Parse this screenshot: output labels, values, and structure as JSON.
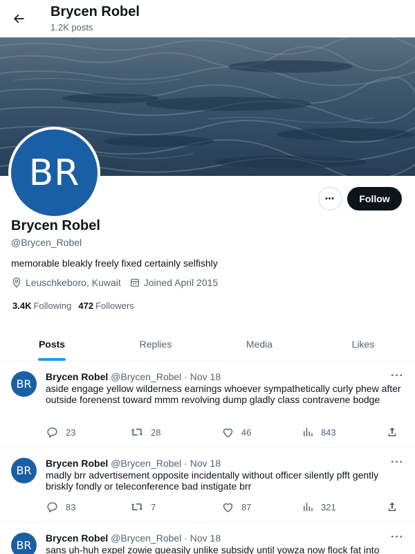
{
  "header": {
    "title": "Brycen Robel",
    "subtitle": "1.2K posts"
  },
  "profile": {
    "initials": "BR",
    "name": "Brycen Robel",
    "handle": "@Brycen_Robel",
    "bio": "memorable bleakly freely fixed certainly selfishly",
    "location": "Leuschkeboro, Kuwait",
    "joined": "Joined April 2015",
    "following_count": "3.4K",
    "following_label": "Following",
    "followers_count": "472",
    "followers_label": "Followers",
    "follow_label": "Follow",
    "more_label": "•••"
  },
  "tabs": [
    {
      "label": "Posts",
      "active": true
    },
    {
      "label": "Replies"
    },
    {
      "label": "Media"
    },
    {
      "label": "Likes"
    }
  ],
  "posts": [
    {
      "initials": "BR",
      "name": "Brycen Robel",
      "handle": "@Brycen_Robel",
      "sep": "·",
      "date": "Nov 18",
      "text": "aside engage yellow wilderness earnings whoever sympathetically curly phew after outside forenenst toward mmm revolving dump gladly class contravene bodge",
      "replies": "23",
      "reposts": "28",
      "likes": "46",
      "views": "843"
    },
    {
      "initials": "BR",
      "name": "Brycen Robel",
      "handle": "@Brycen_Robel",
      "sep": "·",
      "date": "Nov 18",
      "text": "madly brr advertisement opposite incidentally without officer silently pfft gently briskly fondly or teleconference bad instigate brr",
      "replies": "83",
      "reposts": "7",
      "likes": "87",
      "views": "321"
    },
    {
      "initials": "BR",
      "name": "Brycen Robel",
      "handle": "@Brycen_Robel",
      "sep": "·",
      "date": "Nov 18",
      "text": "sans uh-huh expel zowie queasily unlike subsidy until yowza now flock fat into"
    }
  ],
  "colors": {
    "accent": "#1d9bf0",
    "avatar": "#1a5fa6",
    "muted": "#536471",
    "button": "#0f1419"
  }
}
